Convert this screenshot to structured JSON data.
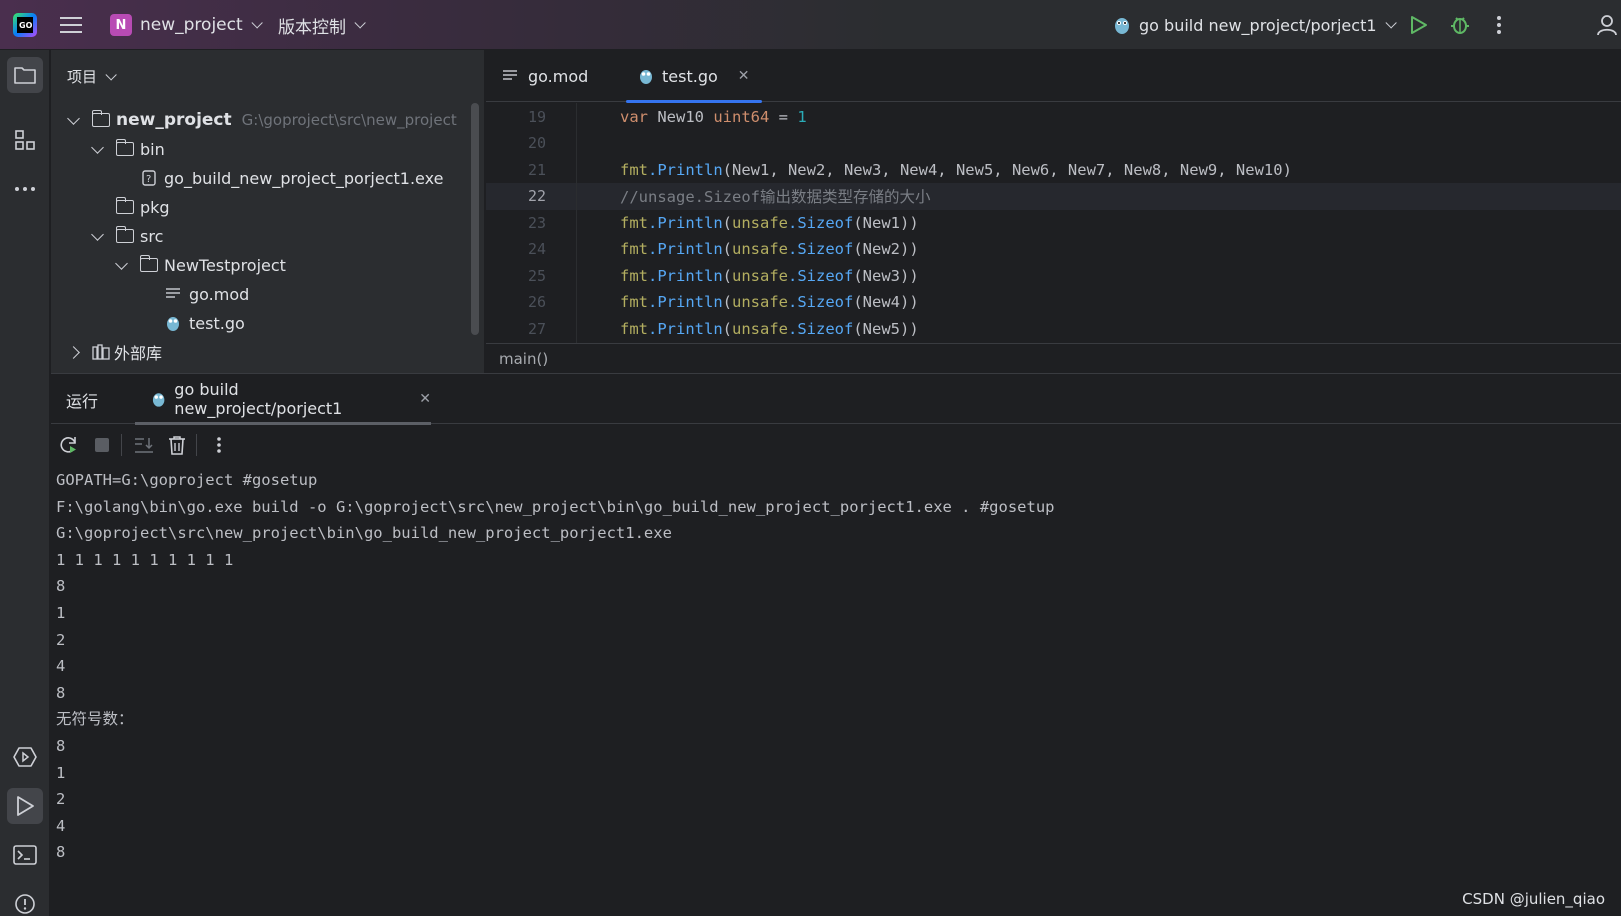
{
  "titlebar": {
    "project_initial": "N",
    "project_name": "new_project",
    "vcs_label": "版本控制",
    "run_config": "go build new_project/porject1",
    "colors": {
      "run_green": "#5fb865",
      "project_badge": "#b84bb4"
    }
  },
  "toolstrip": {
    "icons": [
      "project-folder-icon",
      "structure-icon",
      "more-icon",
      "services-icon",
      "run-icon",
      "terminal-icon",
      "problems-icon"
    ]
  },
  "project_panel": {
    "title": "项目",
    "tree": [
      {
        "label": "new_project",
        "hint": "G:\\goproject\\src\\new_project"
      },
      {
        "label": "bin"
      },
      {
        "label": "go_build_new_project_porject1.exe"
      },
      {
        "label": "pkg"
      },
      {
        "label": "src"
      },
      {
        "label": "NewTestproject"
      },
      {
        "label": "go.mod"
      },
      {
        "label": "test.go"
      },
      {
        "label": "外部库"
      }
    ]
  },
  "editor": {
    "tabs": [
      {
        "label": "go.mod"
      },
      {
        "label": "test.go"
      }
    ],
    "lines": [
      {
        "num": "19"
      },
      {
        "num": "20"
      },
      {
        "num": "21"
      },
      {
        "num": "22"
      },
      {
        "num": "23"
      },
      {
        "num": "24"
      },
      {
        "num": "25"
      },
      {
        "num": "26"
      },
      {
        "num": "27"
      }
    ],
    "code": {
      "l19_var": "var",
      "l19_name": " New10 ",
      "l19_type": "uint64",
      "l19_eq": " = ",
      "l19_val": "1",
      "l21_pkg": "fmt",
      "l21_fn": ".Println",
      "l21_args": "(New1, New2, New3, New4, New5, New6, New7, New8, New9, New10)",
      "l22_comment": "//unsage.Sizeof输出数据类型存储的大小",
      "sizeof_calls": [
        {
          "arg": "(New1))"
        },
        {
          "arg": "(New2))"
        },
        {
          "arg": "(New3))"
        },
        {
          "arg": "(New4))"
        },
        {
          "arg": "(New5))"
        }
      ],
      "unsafe": "unsafe",
      "sizeof": ".Sizeof"
    },
    "breadcrumb": "main()"
  },
  "run_panel": {
    "label": "运行",
    "tab_label": "go build new_project/porject1",
    "console": [
      "GOPATH=G:\\goproject #gosetup",
      "F:\\golang\\bin\\go.exe build -o G:\\goproject\\src\\new_project\\bin\\go_build_new_project_porject1.exe . #gosetup",
      "G:\\goproject\\src\\new_project\\bin\\go_build_new_project_porject1.exe",
      "1 1 1 1 1 1 1 1 1 1",
      "8",
      "1",
      "2",
      "4",
      "8",
      "无符号数：",
      "8",
      "1",
      "2",
      "4",
      "8"
    ]
  },
  "watermark": "CSDN @julien_qiao"
}
